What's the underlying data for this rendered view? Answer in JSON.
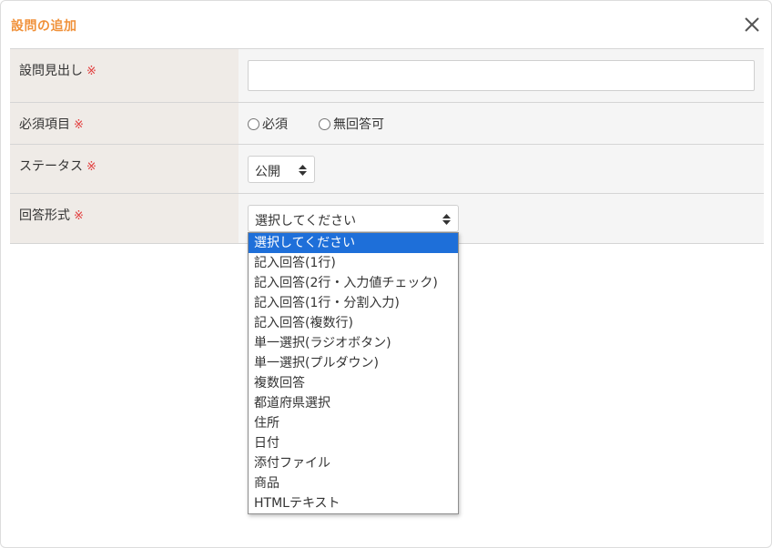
{
  "dialog": {
    "title": "設問の追加",
    "close_icon": "close-icon"
  },
  "form": {
    "required_mark": "※",
    "rows": [
      {
        "label": "設問見出し",
        "type": "text",
        "value": ""
      },
      {
        "label": "必須項目",
        "type": "radio",
        "options": [
          "必須",
          "無回答可"
        ]
      },
      {
        "label": "ステータス",
        "type": "select",
        "value": "公開"
      },
      {
        "label": "回答形式",
        "type": "select",
        "value": "選択してください"
      }
    ]
  },
  "dropdown": {
    "selected_index": 0,
    "highlight_color": "#1e6fd9",
    "options": [
      "選択してください",
      "記入回答(1行)",
      "記入回答(2行・入力値チェック)",
      "記入回答(1行・分割入力)",
      "記入回答(複数行)",
      "単一選択(ラジオボタン)",
      "単一選択(プルダウン)",
      "複数回答",
      "都道府県選択",
      "住所",
      "日付",
      "添付ファイル",
      "商品",
      "HTMLテキスト"
    ]
  },
  "colors": {
    "title": "#f0913a",
    "required": "#e23b3b",
    "label_bg": "#efebe7",
    "value_bg": "#f5f5f5"
  }
}
